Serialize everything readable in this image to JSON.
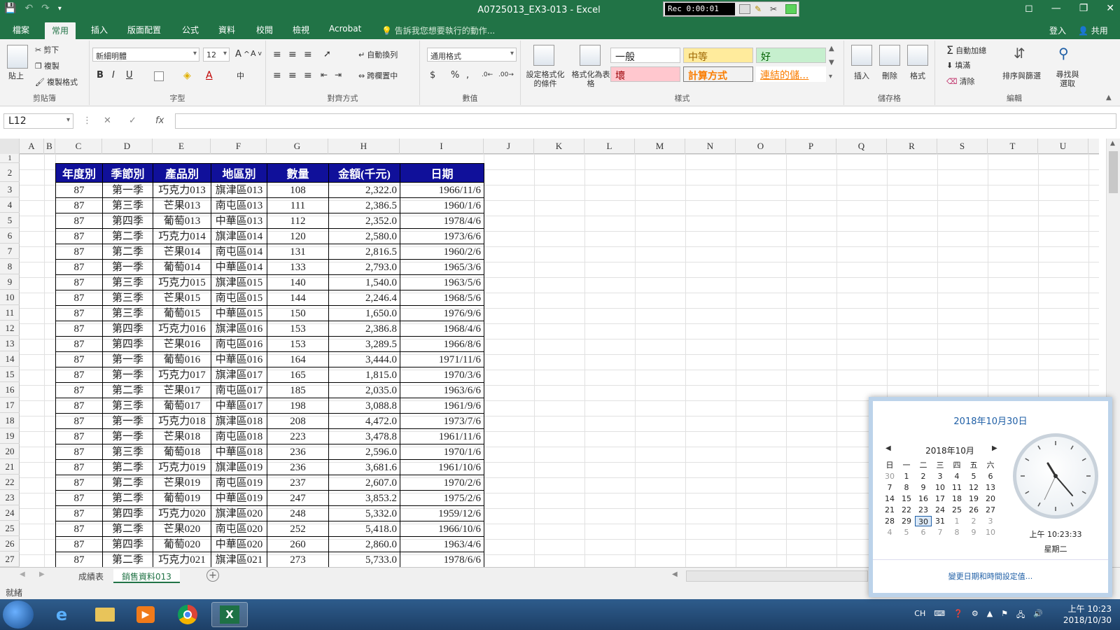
{
  "window": {
    "title": "A0725013_EX3-013 - Excel",
    "rec_time": "Rec 0:00:01"
  },
  "ribbon_tabs": [
    "檔案",
    "常用",
    "插入",
    "版面配置",
    "公式",
    "資料",
    "校閱",
    "檢視",
    "Acrobat"
  ],
  "tell_me": "告訴我您想要執行的動作...",
  "account": {
    "signin": "登入",
    "share": "共用"
  },
  "ribbon": {
    "clipboard": {
      "label": "剪貼簿",
      "paste": "貼上",
      "cut": "剪下",
      "copy": "複製",
      "format_painter": "複製格式"
    },
    "font": {
      "label": "字型",
      "name": "新細明體",
      "size": "12"
    },
    "alignment": {
      "label": "對齊方式",
      "wrap": "自動換列",
      "merge": "跨欄置中"
    },
    "number": {
      "label": "數值",
      "format": "通用格式"
    },
    "styles": {
      "label": "樣式",
      "cond_format": "設定格式化的條件",
      "as_table": "格式化為表格",
      "normal": "一般",
      "neutral": "中等",
      "good": "好",
      "bad": "壞",
      "calc": "計算方式",
      "linked": "連結的儲..."
    },
    "cells": {
      "label": "儲存格",
      "insert": "插入",
      "delete": "刪除",
      "format": "格式"
    },
    "editing": {
      "label": "編輯",
      "autosum": "自動加總",
      "fill": "填滿",
      "clear": "清除",
      "sort": "排序與篩選",
      "find": "尋找與選取"
    }
  },
  "formula_bar": {
    "name_box": "L12",
    "fx": "fx",
    "value": ""
  },
  "columns": [
    "A",
    "B",
    "C",
    "D",
    "E",
    "F",
    "G",
    "H",
    "I",
    "J",
    "K",
    "L",
    "M",
    "N",
    "O",
    "P",
    "Q",
    "R",
    "S",
    "T",
    "U"
  ],
  "rows": [
    "1",
    "2",
    "3",
    "4",
    "5",
    "6",
    "7",
    "8",
    "9",
    "10",
    "11",
    "12",
    "13",
    "14",
    "15",
    "16",
    "17",
    "18",
    "19",
    "20",
    "21",
    "22",
    "23",
    "24",
    "25",
    "26",
    "27"
  ],
  "table": {
    "headers": [
      "年度別",
      "季節別",
      "產品別",
      "地區別",
      "數量",
      "金額(千元)",
      "日期"
    ],
    "rows": [
      [
        "87",
        "第一季",
        "巧克力013",
        "旗津區013",
        "108",
        "2,322.0",
        "1966/11/6"
      ],
      [
        "87",
        "第三季",
        "芒果013",
        "南屯區013",
        "111",
        "2,386.5",
        "1960/1/6"
      ],
      [
        "87",
        "第四季",
        "葡萄013",
        "中華區013",
        "112",
        "2,352.0",
        "1978/4/6"
      ],
      [
        "87",
        "第二季",
        "巧克力014",
        "旗津區014",
        "120",
        "2,580.0",
        "1973/6/6"
      ],
      [
        "87",
        "第二季",
        "芒果014",
        "南屯區014",
        "131",
        "2,816.5",
        "1960/2/6"
      ],
      [
        "87",
        "第一季",
        "葡萄014",
        "中華區014",
        "133",
        "2,793.0",
        "1965/3/6"
      ],
      [
        "87",
        "第三季",
        "巧克力015",
        "旗津區015",
        "140",
        "1,540.0",
        "1963/5/6"
      ],
      [
        "87",
        "第三季",
        "芒果015",
        "南屯區015",
        "144",
        "2,246.4",
        "1968/5/6"
      ],
      [
        "87",
        "第三季",
        "葡萄015",
        "中華區015",
        "150",
        "1,650.0",
        "1976/9/6"
      ],
      [
        "87",
        "第四季",
        "巧克力016",
        "旗津區016",
        "153",
        "2,386.8",
        "1968/4/6"
      ],
      [
        "87",
        "第四季",
        "芒果016",
        "南屯區016",
        "153",
        "3,289.5",
        "1966/8/6"
      ],
      [
        "87",
        "第一季",
        "葡萄016",
        "中華區016",
        "164",
        "3,444.0",
        "1971/11/6"
      ],
      [
        "87",
        "第一季",
        "巧克力017",
        "旗津區017",
        "165",
        "1,815.0",
        "1970/3/6"
      ],
      [
        "87",
        "第二季",
        "芒果017",
        "南屯區017",
        "185",
        "2,035.0",
        "1963/6/6"
      ],
      [
        "87",
        "第三季",
        "葡萄017",
        "中華區017",
        "198",
        "3,088.8",
        "1961/9/6"
      ],
      [
        "87",
        "第一季",
        "巧克力018",
        "旗津區018",
        "208",
        "4,472.0",
        "1973/7/6"
      ],
      [
        "87",
        "第一季",
        "芒果018",
        "南屯區018",
        "223",
        "3,478.8",
        "1961/11/6"
      ],
      [
        "87",
        "第三季",
        "葡萄018",
        "中華區018",
        "236",
        "2,596.0",
        "1970/1/6"
      ],
      [
        "87",
        "第二季",
        "巧克力019",
        "旗津區019",
        "236",
        "3,681.6",
        "1961/10/6"
      ],
      [
        "87",
        "第二季",
        "芒果019",
        "南屯區019",
        "237",
        "2,607.0",
        "1970/2/6"
      ],
      [
        "87",
        "第二季",
        "葡萄019",
        "中華區019",
        "247",
        "3,853.2",
        "1975/2/6"
      ],
      [
        "87",
        "第四季",
        "巧克力020",
        "旗津區020",
        "248",
        "5,332.0",
        "1959/12/6"
      ],
      [
        "87",
        "第二季",
        "芒果020",
        "南屯區020",
        "252",
        "5,418.0",
        "1966/10/6"
      ],
      [
        "87",
        "第四季",
        "葡萄020",
        "中華區020",
        "260",
        "2,860.0",
        "1963/4/6"
      ],
      [
        "87",
        "第二季",
        "巧克力021",
        "旗津區021",
        "273",
        "5,733.0",
        "1978/6/6"
      ]
    ]
  },
  "sheets": {
    "tabs": [
      "成績表",
      "銷售資料013"
    ],
    "active": 1
  },
  "status": {
    "text": "就緒"
  },
  "calendar": {
    "full_date": "2018年10月30日",
    "month": "2018年10月",
    "weekdays": [
      "日",
      "一",
      "二",
      "三",
      "四",
      "五",
      "六"
    ],
    "days": [
      "30",
      "1",
      "2",
      "3",
      "4",
      "5",
      "6",
      "7",
      "8",
      "9",
      "10",
      "11",
      "12",
      "13",
      "14",
      "15",
      "16",
      "17",
      "18",
      "19",
      "20",
      "21",
      "22",
      "23",
      "24",
      "25",
      "26",
      "27",
      "28",
      "29",
      "30",
      "31",
      "1",
      "2",
      "3",
      "4",
      "5",
      "6",
      "7",
      "8",
      "9",
      "10"
    ],
    "today_index": 30,
    "time": "上午 10:23:33",
    "weekday": "星期二",
    "link": "變更日期和時間設定值..."
  },
  "taskbar": {
    "ime": "CH",
    "clock_time": "上午 10:23",
    "clock_date": "2018/10/30"
  },
  "colors": {
    "excel_green": "#217346",
    "header_blue": "#10109a",
    "link_blue": "#1f5fa6"
  }
}
